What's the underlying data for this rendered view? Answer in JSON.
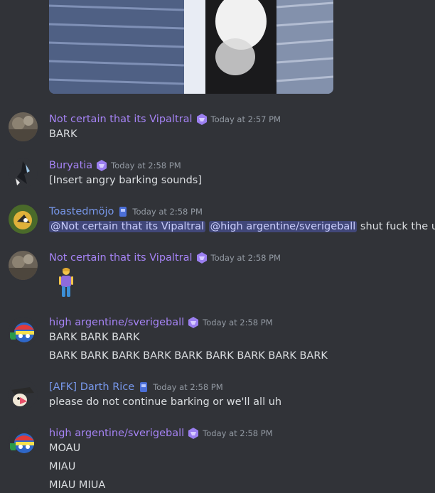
{
  "channel": {
    "messages": [
      {
        "author": "Not certain that its Vipaltral",
        "timestamp": "Today at 2:57 PM",
        "lines": [
          "BARK"
        ]
      },
      {
        "author": "Buryatia",
        "timestamp": "Today at 2:58 PM",
        "lines": [
          "[Insert angry barking sounds]"
        ]
      },
      {
        "author": "Toastedmöjo",
        "timestamp": "Today at 2:58 PM",
        "mentions": [
          "@Not certain that its Vipaltral",
          "@high argentine/sverigeball"
        ],
        "text_after_mentions": "shut fuck the up."
      },
      {
        "author": "Not certain that its Vipaltral",
        "timestamp": "Today at 2:58 PM",
        "emoji": "person-standing-emoji"
      },
      {
        "author": "high argentine/sverigeball",
        "timestamp": "Today at 2:58 PM",
        "lines": [
          "BARK BARK BARK",
          "BARK BARK BARK BARK BARK BARK BARK BARK BARK"
        ]
      },
      {
        "author": "[AFK] Darth Rice",
        "timestamp": "Today at 2:58 PM",
        "lines": [
          "please do not continue barking or we'll all uh"
        ]
      },
      {
        "author": "high argentine/sverigeball",
        "timestamp": "Today at 2:58 PM",
        "lines": [
          "MOAU",
          "MIAU",
          "MIAU MIUA"
        ]
      }
    ]
  },
  "colors": {
    "background": "#313338",
    "username_purple": "#a583f4",
    "username_blue": "#7898eb",
    "timestamp": "#949ba4",
    "text": "#dbdee1",
    "mention_bg": "#414779"
  }
}
